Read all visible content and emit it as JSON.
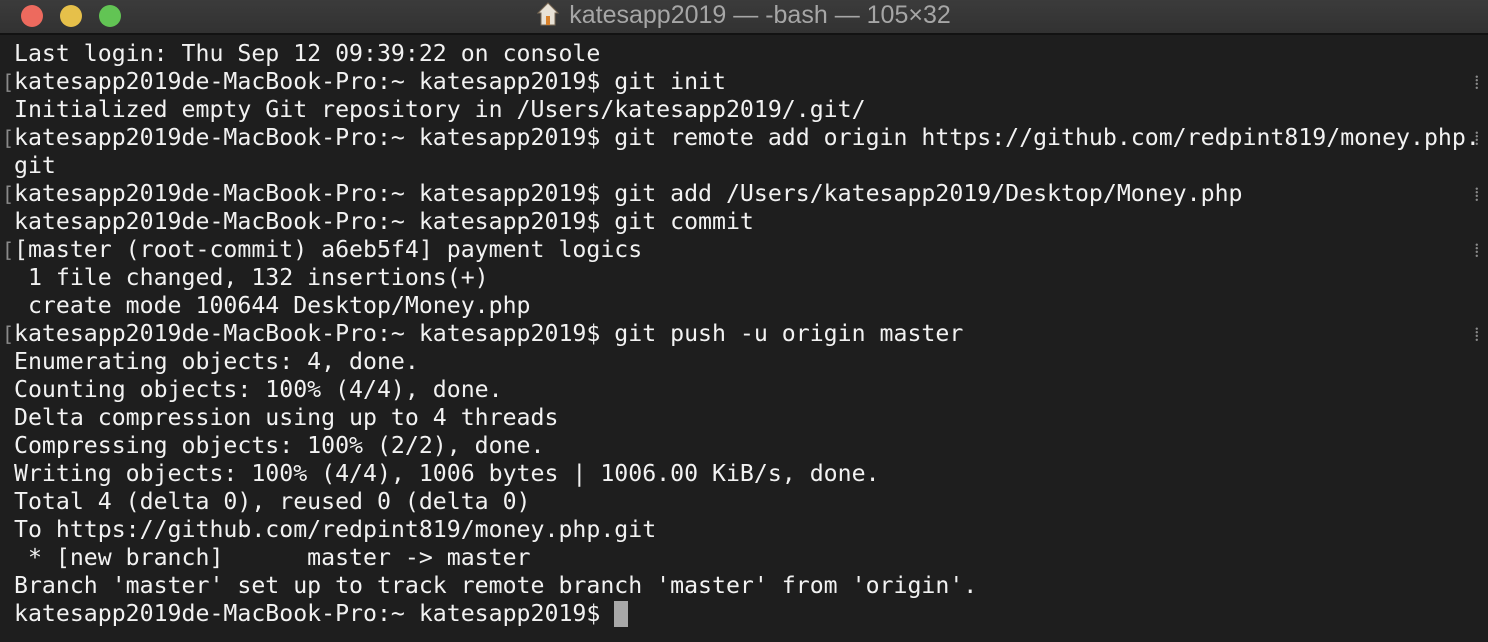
{
  "window": {
    "title": "katesapp2019 — -bash — 105×32",
    "icon": "home-folder-icon"
  },
  "terminal": {
    "lines": [
      {
        "text": "Last login: Thu Sep 12 09:39:22 on console",
        "mark": false
      },
      {
        "text": "katesapp2019de-MacBook-Pro:~ katesapp2019$ git init",
        "mark": true
      },
      {
        "text": "Initialized empty Git repository in /Users/katesapp2019/.git/",
        "mark": false
      },
      {
        "text": "katesapp2019de-MacBook-Pro:~ katesapp2019$ git remote add origin https://github.com/redpint819/money.php.",
        "mark": true
      },
      {
        "text": "git",
        "mark": false
      },
      {
        "text": "katesapp2019de-MacBook-Pro:~ katesapp2019$ git add /Users/katesapp2019/Desktop/Money.php",
        "mark": true
      },
      {
        "text": "katesapp2019de-MacBook-Pro:~ katesapp2019$ git commit",
        "mark": false
      },
      {
        "text": "[master (root-commit) a6eb5f4] payment logics",
        "mark": true
      },
      {
        "text": " 1 file changed, 132 insertions(+)",
        "mark": false
      },
      {
        "text": " create mode 100644 Desktop/Money.php",
        "mark": false
      },
      {
        "text": "katesapp2019de-MacBook-Pro:~ katesapp2019$ git push -u origin master",
        "mark": true
      },
      {
        "text": "Enumerating objects: 4, done.",
        "mark": false
      },
      {
        "text": "Counting objects: 100% (4/4), done.",
        "mark": false
      },
      {
        "text": "Delta compression using up to 4 threads",
        "mark": false
      },
      {
        "text": "Compressing objects: 100% (2/2), done.",
        "mark": false
      },
      {
        "text": "Writing objects: 100% (4/4), 1006 bytes | 1006.00 KiB/s, done.",
        "mark": false
      },
      {
        "text": "Total 4 (delta 0), reused 0 (delta 0)",
        "mark": false
      },
      {
        "text": "To https://github.com/redpint819/money.php.git",
        "mark": false
      },
      {
        "text": " * [new branch]      master -> master",
        "mark": false
      },
      {
        "text": "Branch 'master' set up to track remote branch 'master' from 'origin'.",
        "mark": false
      },
      {
        "text": "katesapp2019de-MacBook-Pro:~ katesapp2019$ ",
        "mark": false,
        "cursor": true
      }
    ]
  }
}
